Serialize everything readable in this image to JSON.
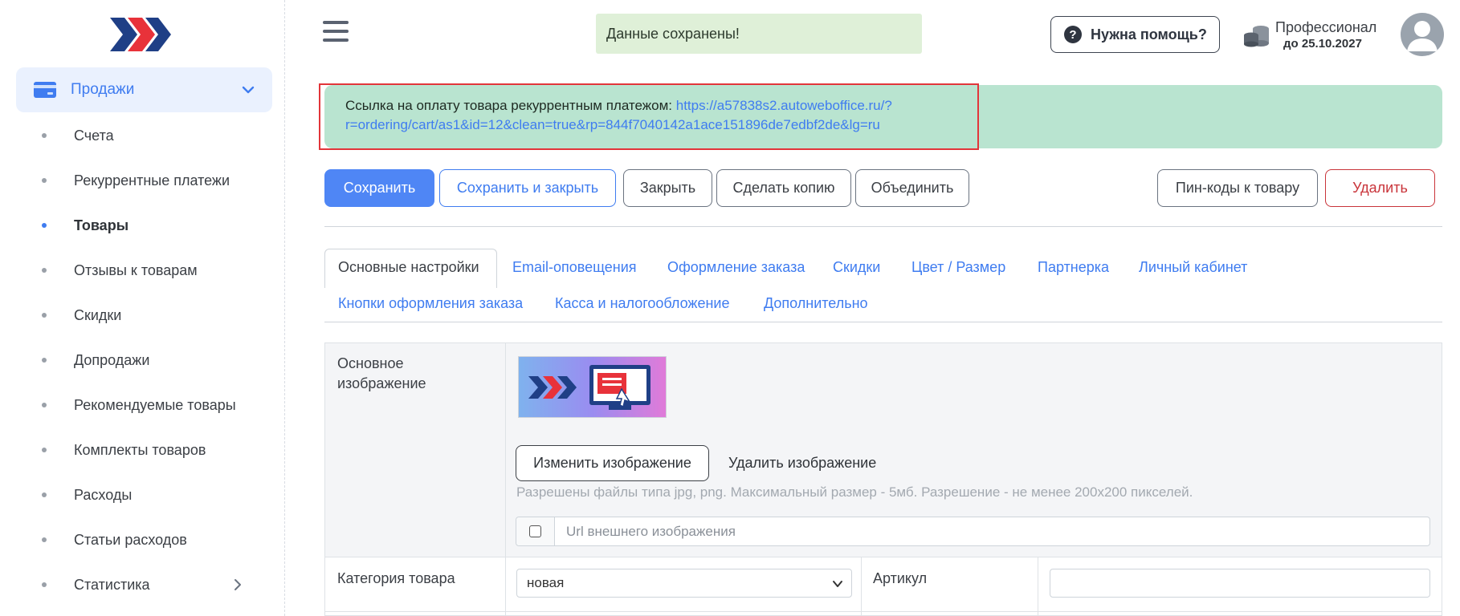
{
  "sidebar": {
    "group": {
      "label": "Продажи",
      "icon": "credit-card-icon"
    },
    "items": [
      {
        "label": "Счета",
        "active": false
      },
      {
        "label": "Рекуррентные платежи",
        "active": false
      },
      {
        "label": "Товары",
        "active": true
      },
      {
        "label": "Отзывы к товарам",
        "active": false
      },
      {
        "label": "Скидки",
        "active": false
      },
      {
        "label": "Допродажи",
        "active": false
      },
      {
        "label": "Рекомендуемые товары",
        "active": false
      },
      {
        "label": "Комплекты товаров",
        "active": false
      },
      {
        "label": "Расходы",
        "active": false
      },
      {
        "label": "Статьи расходов",
        "active": false
      },
      {
        "label": "Статистика",
        "active": false,
        "has_submenu": true
      }
    ]
  },
  "header": {
    "toast": "Данные сохранены!",
    "help_button": "Нужна помощь?",
    "plan_name": "Профессионал",
    "plan_until": "до 25.10.2027"
  },
  "banner": {
    "text": "Ссылка на оплату товара рекуррентным платежом: ",
    "link": "https://a57838s2.autoweboffice.ru/?r=ordering/cart/as1&id=12&clean=true&rp=844f7040142a1ace151896de7edbf2de&lg=ru"
  },
  "actions": {
    "save": "Сохранить",
    "save_close": "Сохранить и закрыть",
    "close": "Закрыть",
    "copy": "Сделать копию",
    "merge": "Объединить",
    "pin_codes": "Пин-коды к товару",
    "delete": "Удалить"
  },
  "tabs": [
    {
      "label": "Основные настройки",
      "active": true
    },
    {
      "label": "Email-оповещения"
    },
    {
      "label": "Оформление заказа"
    },
    {
      "label": "Скидки"
    },
    {
      "label": "Цвет / Размер"
    },
    {
      "label": "Партнерка"
    },
    {
      "label": "Личный кабинет"
    },
    {
      "label": "Кнопки оформления заказа"
    },
    {
      "label": "Касса и налогообложение"
    },
    {
      "label": "Дополнительно"
    }
  ],
  "form": {
    "main_image_label": "Основное изображение",
    "change_image": "Изменить изображение",
    "delete_image": "Удалить изображение",
    "hint": "Разрешены файлы типа jpg, png. Максимальный размер - 5мб. Разрешение - не менее 200x200 пикселей.",
    "url_placeholder": "Url внешнего изображения",
    "category_label": "Категория товара",
    "category_value": "новая",
    "sku_label": "Артикул",
    "sku_value": ""
  },
  "colors": {
    "accent": "#4f86f5",
    "link": "#3f7cf0",
    "banner_bg": "#b9e4d0",
    "toast_bg": "#dff0d8",
    "danger": "#c9343a",
    "highlight": "#e2353a"
  }
}
